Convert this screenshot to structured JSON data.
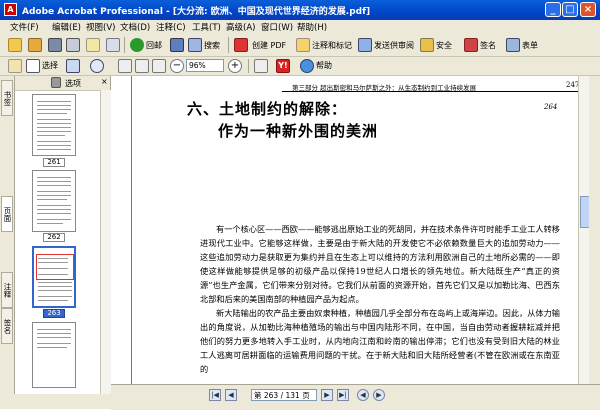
{
  "window": {
    "title": "Adobe Acrobat Professional - [大分流: 欧洲、中国及现代世界经济的发展.pdf]",
    "app_icon_letter": "A",
    "controls": [
      "_",
      "□",
      "×"
    ]
  },
  "menubar": {
    "items": [
      "文件(F)",
      "编辑(E)",
      "视图(V)",
      "文档(D)",
      "注释(C)",
      "工具(T)",
      "高级(A)",
      "窗口(W)",
      "帮助(H)"
    ]
  },
  "toolbar1": {
    "search_label": "搜索",
    "create_pdf_label": "创建 PDF",
    "comment_label": "注释和标记",
    "send_review_label": "发送供审阅",
    "secure_label": "安全",
    "sign_label": "签名",
    "forms_label": "表单",
    "online_label": "回邮"
  },
  "toolbar2": {
    "select_label": "选择",
    "zoom_value": "96%",
    "help_label": "帮助"
  },
  "nav_tabs": [
    "书签",
    "页面",
    "注释",
    "签名"
  ],
  "thumb_panel": {
    "header_label": "选项",
    "thumbnails": [
      {
        "label": "261",
        "selected": false
      },
      {
        "label": "262",
        "selected": false
      },
      {
        "label": "263",
        "selected": true
      }
    ]
  },
  "document": {
    "running_header": "第三部分  超出斯密和马尔萨斯之外：从生态制约到工业持续发展",
    "page_number": "247",
    "handwritten_number": "264",
    "heading_line1": "六、土地制约的解除：",
    "heading_line2": "作为一种新外围的美洲",
    "paragraph1": "有一个核心区——西欧——能够逃出原始工业的死胡同，并在技术条件许可时能手工业工人转移进现代工业中。它能够这样做，主要是由于新大陆的开发使它不必依赖数量巨大的追加劳动力——这些追加劳动力是获取更为集约并且在生态上可以维持的方法利用欧洲自己的土地所必需的——即使这样做能够提供足够的初级产品以保持19世纪人口增长的领先地位。新大陆既生产“真正的资源”也生产金属，它们带来分别对待。它我们从前面的资源开始，首先它们又是以加勒比海、巴西东北部和后来的美国南部的种植园产品为起点。",
    "paragraph2": "新大陆输出的农产品主要由奴隶种植，种植园几乎全部分布在岛屿上或海岸边。因此，从体力输出的角度说，从加勒比海种植殖场的输出与中国内陆形不同，在中国，当自由劳动者握耕耘减并把他们的努力更多地转入手工业时，从内地向江南和岭南的输出停滞；它们也没有受到旧大陆的林业工人逃离可居耕面临的运输费用问题的干扰。在于新大陆和旧大陆所经营者(不管在欧洲或在东南亚的"
  },
  "statusbar": {
    "page_display": "第 263 / 131 页",
    "buttons": [
      "|◀",
      "◀",
      "▶",
      "▶|",
      "◀",
      "▶"
    ]
  }
}
